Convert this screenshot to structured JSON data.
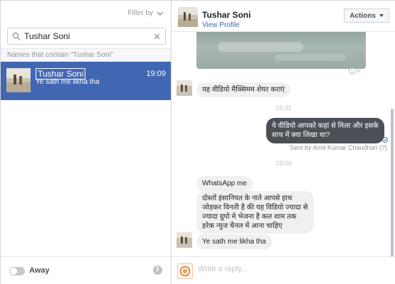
{
  "left": {
    "filter_label": "Filter by",
    "search": {
      "value": "Tushar Soni",
      "placeholder": ""
    },
    "names_label": "Names that contain “Tushar Soni”",
    "conversation": {
      "name": "Tushar Soni",
      "time": "19:09",
      "snippet": "Ye sath me likha tha"
    },
    "status_label": "Away"
  },
  "header": {
    "title": "Tushar Soni",
    "view_profile": "View Profile",
    "actions_label": "Actions"
  },
  "thread": {
    "msg1": "यह वीडियो मैक्सिमम शेयर कराएं",
    "ts1": "15:32",
    "out_line1": "ये वीडियो आपको कहां से मिला और इसके",
    "out_line2": "साथ में क्या लिखा था?",
    "sent_by": "Sent by Amit Kumar Chaudhari (?)",
    "ts2": "19:09",
    "msg2": "WhatsApp me",
    "msg3_l1": "दोस्तों इंसानियत के नाते आपसे हाथ",
    "msg3_l2": "जोड़कर विनती है की यह विडियो ज्यादा से",
    "msg3_l3": "ज्यादा ग्रुपो मे भेजना है कल शाम तक",
    "msg3_l4": "हरेक न्युज चैनल में आना चाहिए",
    "msg4": "Ye sath me likha tha"
  },
  "reply": {
    "placeholder": "Write a reply..."
  },
  "colors": {
    "accent": "#4267b2",
    "outgoing_bubble": "#4b4f56",
    "incoming_bubble": "#f1f0f0"
  }
}
